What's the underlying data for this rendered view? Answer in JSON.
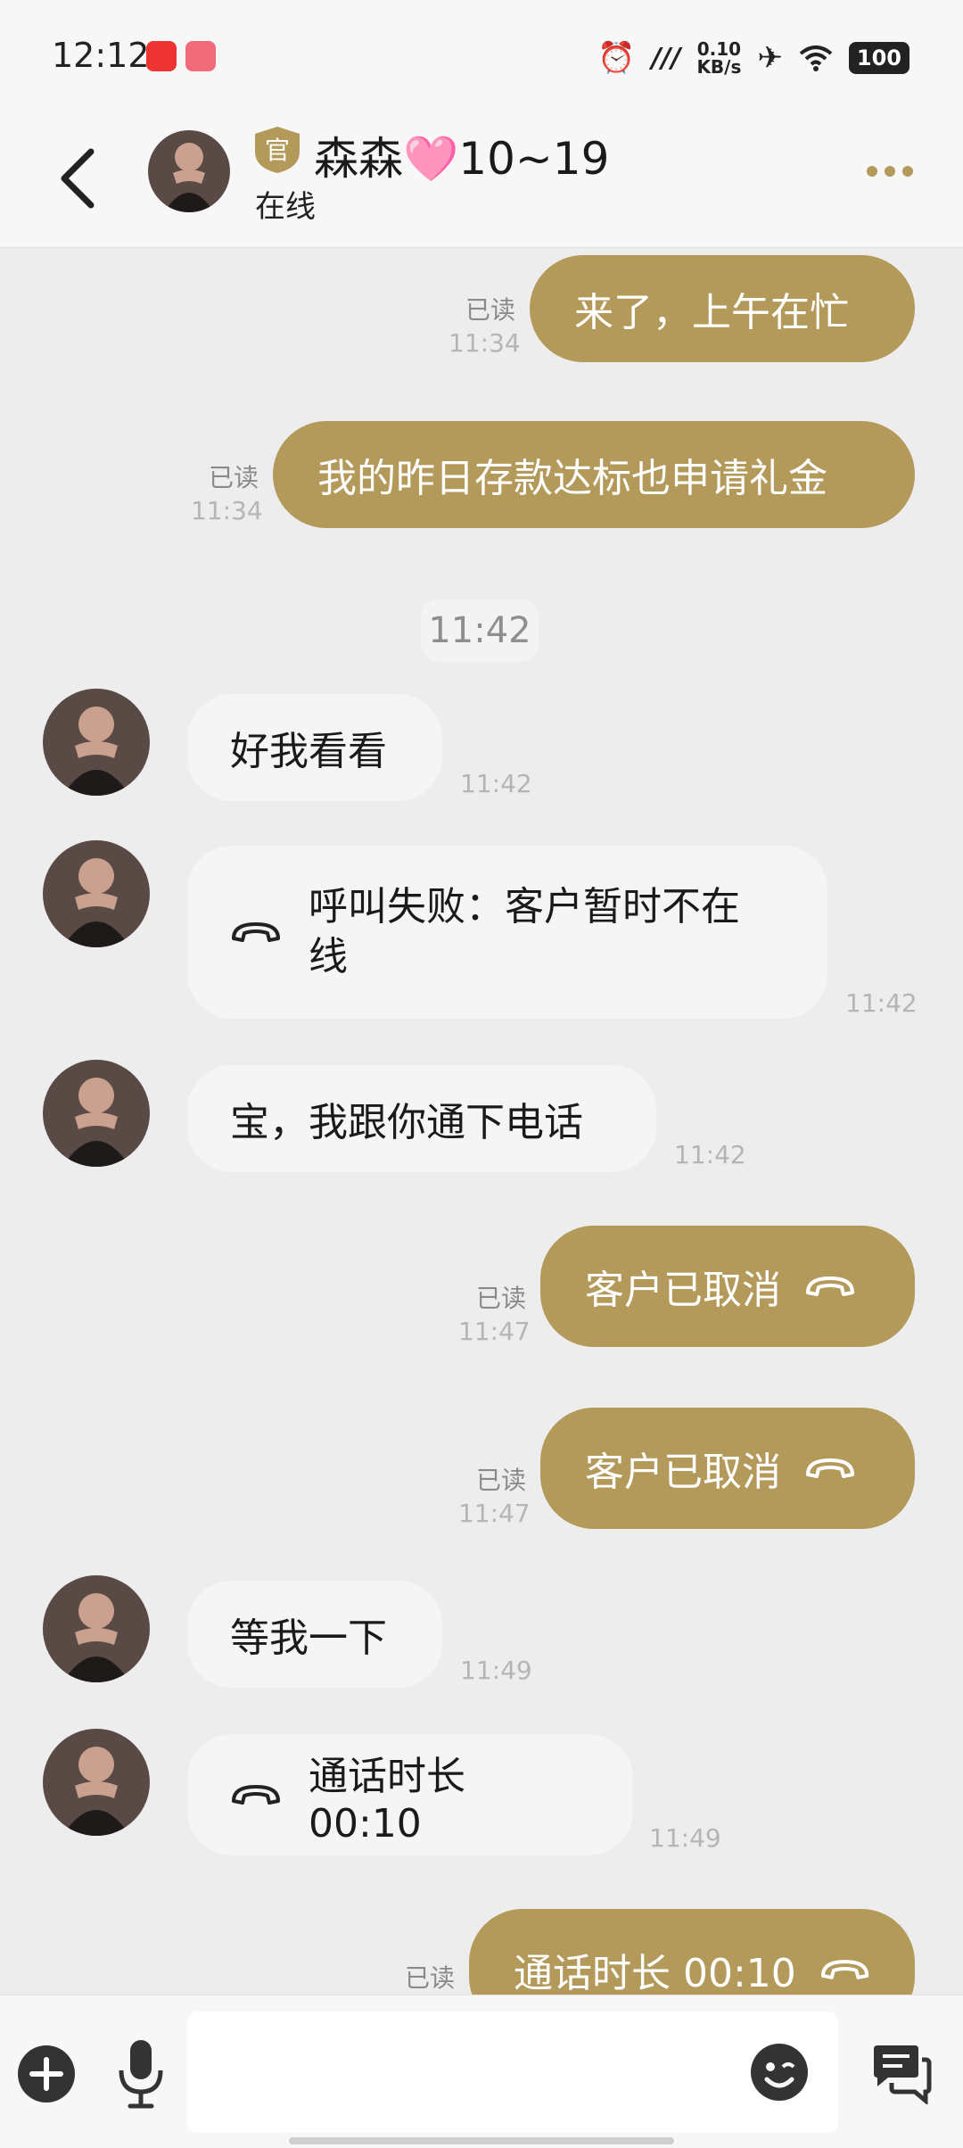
{
  "status_bar": {
    "time": "12:12",
    "net_speed_top": "0.10",
    "net_speed_unit": "KB/s",
    "battery": "100"
  },
  "header": {
    "badge": "官",
    "name": "森森🩷10~19",
    "status": "在线"
  },
  "read_label": "已读",
  "messages": [
    {
      "dir": "out",
      "text": "来了，上午在忙",
      "time": "11:34"
    },
    {
      "dir": "out",
      "text": "我的昨日存款达标也申请礼金",
      "time": "11:34"
    },
    {
      "dir": "divider",
      "text": "11:42"
    },
    {
      "dir": "in",
      "text": "好我看看",
      "time": "11:42"
    },
    {
      "dir": "in",
      "text_line1": "呼叫失败：客户暂时不在",
      "text_line2": "线",
      "time": "11:42"
    },
    {
      "dir": "in",
      "text": "宝，我跟你通下电话",
      "time": "11:42"
    },
    {
      "dir": "out",
      "text": "客户已取消",
      "time": "11:47"
    },
    {
      "dir": "out",
      "text": "客户已取消",
      "time": "11:47"
    },
    {
      "dir": "in",
      "text": "等我一下",
      "time": "11:49"
    },
    {
      "dir": "in",
      "text": "通话时长 00:10",
      "time": "11:49"
    },
    {
      "dir": "out",
      "text": "通话时长 00:10"
    }
  ],
  "icons": {
    "back": "chevron-left-icon",
    "more": "more-dots-icon",
    "phone": "phone-hangup-icon",
    "plus": "plus-icon",
    "mic": "microphone-icon",
    "emoji": "emoji-icon",
    "chat": "chat-bubbles-icon"
  },
  "colors": {
    "accent": "#b39a5b",
    "background": "#ededed",
    "incoming_bubble": "#f5f5f5"
  }
}
